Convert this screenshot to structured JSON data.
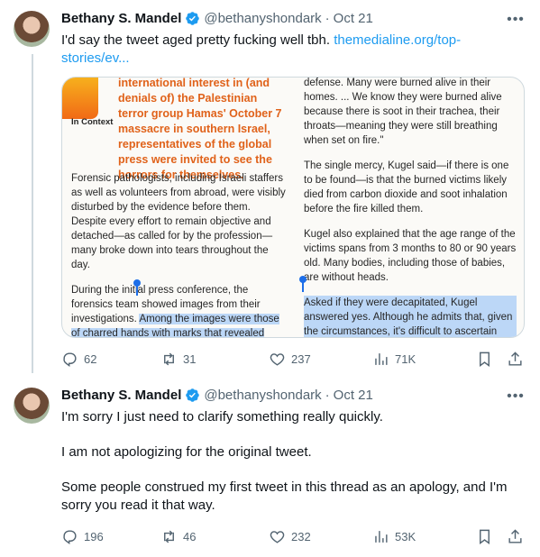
{
  "tweets": [
    {
      "name": "Bethany S. Mandel",
      "handle": "@bethanyshondark",
      "separator": "·",
      "date": "Oct 21",
      "text": "I'd say the tweet aged pretty fucking well tbh.",
      "link": "themedialine.org/top-stories/ev...",
      "stats": {
        "replies": "62",
        "reposts": "31",
        "likes": "237",
        "views": "71K"
      }
    },
    {
      "name": "Bethany S. Mandel",
      "handle": "@bethanyshondark",
      "separator": "·",
      "date": "Oct 21",
      "paragraphs": [
        "I'm sorry I just need to clarify something really quickly.",
        "I am not apologizing for the original tweet.",
        "Some people construed my first tweet in this thread as an apology, and I'm sorry you read it that way."
      ],
      "stats": {
        "replies": "196",
        "reposts": "46",
        "likes": "232",
        "views": "53K"
      }
    }
  ],
  "article": {
    "incontext": "In Context",
    "pullquote": "international interest in (and denials of) the Palestinian terror group Hamas' October 7 massacre in southern Israel, representatives of the global press were invited to see the horrors for themselves.",
    "left_p1": "Forensic pathologists, including Israeli staffers as well as volunteers from abroad, were visibly disturbed by the evidence before them. Despite every effort to remain objective and detached—as called for by the profession—many broke down into tears throughout the day.",
    "left_p2_a": "During the initial press conference, the forensics team showed images from their investigations.",
    "left_p2_b": "Among the images were those of charred hands with marks that revealed where the victims' hands were bound behind their backs with metal wire before being",
    "right_p1": "defense. Many were burned alive in their homes. ... We know they were burned alive because there is soot in their trachea, their throats—meaning they were still breathing when set on fire.\"",
    "right_p2": "The single mercy, Kugel said—if there is one to be found—is that the burned victims likely died from carbon dioxide and soot inhalation before the fire killed them.",
    "right_p3": "Kugel also explained that the age range of the victims spans from 3 months to 80 or 90 years old. Many bodies, including those of babies, are without heads.",
    "right_p4": "Asked if they were decapitated, Kugel answered yes. Although he admits that, given the circumstances, it's difficult to ascertain whether they were decapitated before or after"
  },
  "icons": {
    "verified": "verified-badge-icon",
    "more": "more-options-icon",
    "reply": "reply-icon",
    "repost": "repost-icon",
    "like": "like-icon",
    "views": "views-icon",
    "bookmark": "bookmark-icon",
    "share": "share-icon"
  },
  "colors": {
    "accent": "#1d9bf0",
    "text": "#0f1419",
    "muted": "#536471",
    "pullquote": "#e0621a",
    "highlight": "#bcd7f7"
  }
}
